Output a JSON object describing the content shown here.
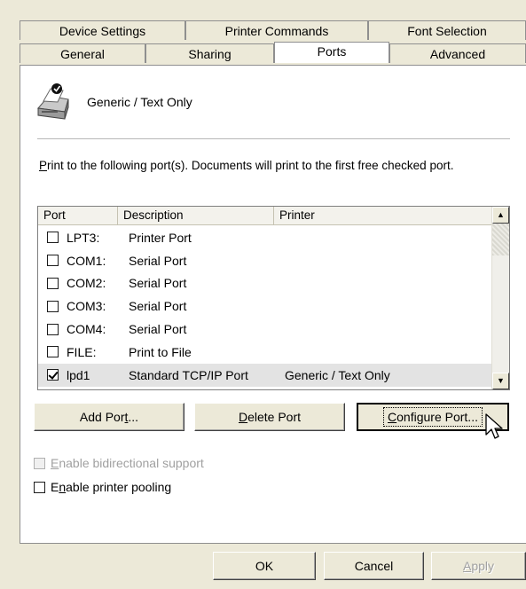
{
  "tabs_back": [
    "Device Settings",
    "Printer Commands",
    "Font Selection"
  ],
  "tabs_front": [
    "General",
    "Sharing",
    "Ports",
    "Advanced"
  ],
  "active_tab": "Ports",
  "printer_name": "Generic / Text Only",
  "intro_text_rest": "rint to the following port(s). Documents will print to the first free checked port.",
  "intro_accel": "P",
  "columns": [
    "Port",
    "Description",
    "Printer"
  ],
  "ports": [
    {
      "port": "LPT3:",
      "description": "Printer Port",
      "printer": "",
      "checked": false
    },
    {
      "port": "COM1:",
      "description": "Serial Port",
      "printer": "",
      "checked": false
    },
    {
      "port": "COM2:",
      "description": "Serial Port",
      "printer": "",
      "checked": false
    },
    {
      "port": "COM3:",
      "description": "Serial Port",
      "printer": "",
      "checked": false
    },
    {
      "port": "COM4:",
      "description": "Serial Port",
      "printer": "",
      "checked": false
    },
    {
      "port": "FILE:",
      "description": "Print to File",
      "printer": "",
      "checked": false
    },
    {
      "port": "lpd1",
      "description": "Standard TCP/IP Port",
      "printer": "Generic / Text Only",
      "checked": true
    }
  ],
  "buttons": {
    "add_port_a": "Add Por",
    "add_port_u": "t",
    "add_port_b": "...",
    "delete_port_u": "D",
    "delete_port_rest": "elete Port",
    "configure_port_u": "C",
    "configure_port_rest": "onfigure Port..."
  },
  "bidi_label_u": "E",
  "bidi_label_rest": "nable bidirectional support",
  "pooling_label_a": "E",
  "pooling_label_u": "n",
  "pooling_label_rest": "able printer pooling",
  "footer": {
    "ok": "OK",
    "cancel": "Cancel",
    "apply_u": "A",
    "apply_rest": "pply"
  },
  "scroll_up": "▲",
  "scroll_down": "▼"
}
